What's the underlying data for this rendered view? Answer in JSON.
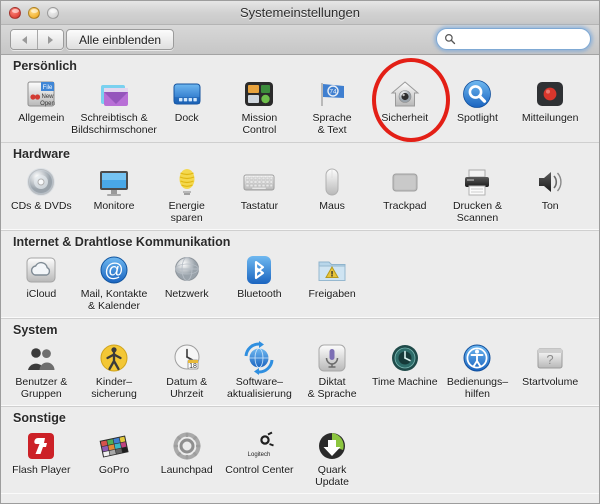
{
  "window": {
    "title": "Systemeinstellungen",
    "traffic_lights": [
      {
        "name": "close",
        "color": "#e0453c",
        "enabled": true
      },
      {
        "name": "minimize",
        "color": "#f2b231",
        "enabled": true
      },
      {
        "name": "zoom",
        "color": "#d6d6d6",
        "enabled": false
      }
    ]
  },
  "toolbar": {
    "back_label": "◀",
    "forward_label": "▶",
    "show_all_label": "Alle einblenden",
    "search": {
      "value": "",
      "placeholder": "",
      "focused": true,
      "icon": "search-icon"
    }
  },
  "annotation": {
    "type": "circle-highlight",
    "color": "#e31f16",
    "target": "Sicherheit"
  },
  "sections": [
    {
      "id": "personal",
      "title": "Persönlich",
      "items": [
        {
          "id": "allgemein",
          "label": "Allgemein",
          "icon": "general-icon"
        },
        {
          "id": "schreibtisch",
          "label": "Schreibtisch &\nBildschirmschoner",
          "icon": "desktop-screensaver-icon"
        },
        {
          "id": "dock",
          "label": "Dock",
          "icon": "dock-icon"
        },
        {
          "id": "mission",
          "label": "Mission\nControl",
          "icon": "mission-control-icon"
        },
        {
          "id": "sprache",
          "label": "Sprache\n& Text",
          "icon": "language-text-icon"
        },
        {
          "id": "sicherheit",
          "label": "Sicherheit",
          "icon": "security-house-icon"
        },
        {
          "id": "spotlight",
          "label": "Spotlight",
          "icon": "spotlight-icon"
        },
        {
          "id": "mitteilungen",
          "label": "Mitteilungen",
          "icon": "notifications-icon"
        }
      ]
    },
    {
      "id": "hardware",
      "title": "Hardware",
      "items": [
        {
          "id": "cds",
          "label": "CDs & DVDs",
          "icon": "cd-dvd-icon"
        },
        {
          "id": "monitore",
          "label": "Monitore",
          "icon": "display-icon"
        },
        {
          "id": "energie",
          "label": "Energie\nsparen",
          "icon": "energy-saver-icon"
        },
        {
          "id": "tastatur",
          "label": "Tastatur",
          "icon": "keyboard-icon"
        },
        {
          "id": "maus",
          "label": "Maus",
          "icon": "mouse-icon"
        },
        {
          "id": "trackpad",
          "label": "Trackpad",
          "icon": "trackpad-icon"
        },
        {
          "id": "drucken",
          "label": "Drucken &\nScannen",
          "icon": "printer-icon"
        },
        {
          "id": "ton",
          "label": "Ton",
          "icon": "sound-speaker-icon"
        }
      ]
    },
    {
      "id": "internet",
      "title": "Internet & Drahtlose Kommunikation",
      "items": [
        {
          "id": "icloud",
          "label": "iCloud",
          "icon": "icloud-icon"
        },
        {
          "id": "mail",
          "label": "Mail, Kontakte\n& Kalender",
          "icon": "mail-accounts-icon"
        },
        {
          "id": "netzwerk",
          "label": "Netzwerk",
          "icon": "network-globe-icon"
        },
        {
          "id": "bluetooth",
          "label": "Bluetooth",
          "icon": "bluetooth-icon"
        },
        {
          "id": "freigaben",
          "label": "Freigaben",
          "icon": "sharing-folder-icon"
        }
      ]
    },
    {
      "id": "system",
      "title": "System",
      "items": [
        {
          "id": "benutzer",
          "label": "Benutzer &\nGruppen",
          "icon": "users-groups-icon"
        },
        {
          "id": "kinder",
          "label": "Kinder–\nsicherung",
          "icon": "parental-controls-icon"
        },
        {
          "id": "datum",
          "label": "Datum &\nUhrzeit",
          "icon": "date-time-clock-icon"
        },
        {
          "id": "software",
          "label": "Software–\naktualisierung",
          "icon": "software-update-icon"
        },
        {
          "id": "diktat",
          "label": "Diktat\n& Sprache",
          "icon": "dictation-mic-icon"
        },
        {
          "id": "timemachine",
          "label": "Time Machine",
          "icon": "time-machine-icon"
        },
        {
          "id": "bedienung",
          "label": "Bedienungs–\nhilfen",
          "icon": "accessibility-icon"
        },
        {
          "id": "startvolume",
          "label": "Startvolume",
          "icon": "startup-disk-icon"
        }
      ]
    },
    {
      "id": "other",
      "title": "Sonstige",
      "items": [
        {
          "id": "flash",
          "label": "Flash Player",
          "icon": "flash-player-icon"
        },
        {
          "id": "gopro",
          "label": "GoPro",
          "icon": "gopro-icon"
        },
        {
          "id": "launchpad",
          "label": "Launchpad",
          "icon": "launchpad-gear-icon"
        },
        {
          "id": "logitech",
          "label": "Control Center",
          "icon": "logitech-icon"
        },
        {
          "id": "quark",
          "label": "Quark\nUpdate",
          "icon": "quark-update-icon"
        }
      ]
    }
  ]
}
